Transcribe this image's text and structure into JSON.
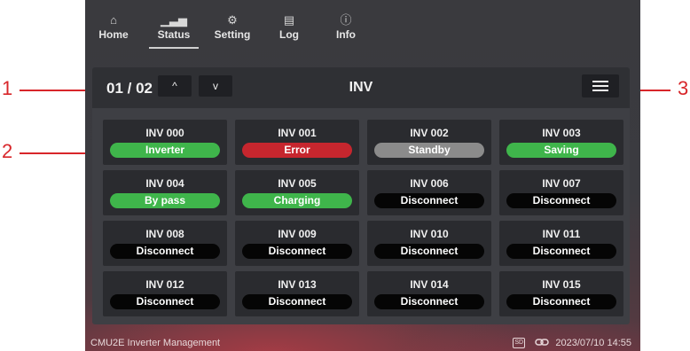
{
  "callouts": [
    "1",
    "2",
    "3"
  ],
  "nav": {
    "items": [
      {
        "label": "Home",
        "icon": "home-icon",
        "glyph": "⌂"
      },
      {
        "label": "Status",
        "icon": "bar-chart-icon",
        "glyph": "▁▃▅"
      },
      {
        "label": "Setting",
        "icon": "gear-icon",
        "glyph": "⚙"
      },
      {
        "label": "Log",
        "icon": "log-icon",
        "glyph": "▤"
      },
      {
        "label": "Info",
        "icon": "info-icon",
        "glyph": "ⓘ"
      }
    ],
    "active": "Status"
  },
  "panel": {
    "page": "01 / 02",
    "up": "^",
    "down": "v",
    "title": "INV",
    "menu_icon": "hamburger-icon"
  },
  "colors": {
    "Inverter": "#3fb54b",
    "Error": "#c6262e",
    "Standby": "#8b8b8b",
    "Saving": "#3fb54b",
    "By pass": "#3fb54b",
    "Charging": "#3fb54b",
    "Disconnect": "#050505"
  },
  "inverters": [
    {
      "name": "INV 000",
      "status": "Inverter"
    },
    {
      "name": "INV 001",
      "status": "Error"
    },
    {
      "name": "INV 002",
      "status": "Standby"
    },
    {
      "name": "INV 003",
      "status": "Saving"
    },
    {
      "name": "INV 004",
      "status": "By pass"
    },
    {
      "name": "INV 005",
      "status": "Charging"
    },
    {
      "name": "INV 006",
      "status": "Disconnect"
    },
    {
      "name": "INV 007",
      "status": "Disconnect"
    },
    {
      "name": "INV 008",
      "status": "Disconnect"
    },
    {
      "name": "INV 009",
      "status": "Disconnect"
    },
    {
      "name": "INV 010",
      "status": "Disconnect"
    },
    {
      "name": "INV 011",
      "status": "Disconnect"
    },
    {
      "name": "INV 012",
      "status": "Disconnect"
    },
    {
      "name": "INV 013",
      "status": "Disconnect"
    },
    {
      "name": "INV 014",
      "status": "Disconnect"
    },
    {
      "name": "INV 015",
      "status": "Disconnect"
    }
  ],
  "footer": {
    "app_name": "CMU2E Inverter Management",
    "sd_label": "SD",
    "datetime": "2023/07/10 14:55"
  }
}
